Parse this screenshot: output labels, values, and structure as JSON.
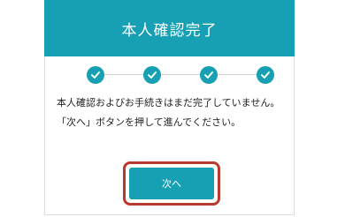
{
  "header": {
    "title": "本人確認完了"
  },
  "stepper": {
    "steps": [
      {
        "status": "completed",
        "icon": "check-icon"
      },
      {
        "status": "completed",
        "icon": "check-icon"
      },
      {
        "status": "completed",
        "icon": "check-icon"
      },
      {
        "status": "completed",
        "icon": "check-icon"
      }
    ]
  },
  "message": {
    "text": "本人確認およびお手続きはまだ完了していません。「次へ」ボタンを押して進んでください。"
  },
  "actions": {
    "next_label": "次へ"
  },
  "colors": {
    "accent": "#17a0b4",
    "highlight": "#b73a2e"
  }
}
